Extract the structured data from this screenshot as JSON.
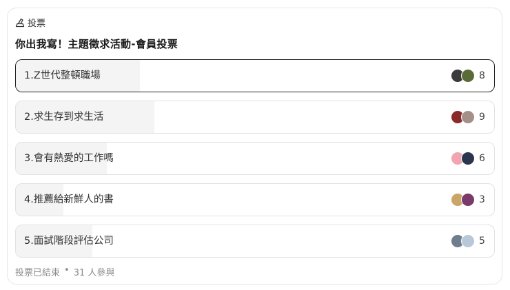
{
  "header": {
    "label": "投票",
    "icon": "ballot-icon"
  },
  "title": "你出我寫！主題徵求活動-會員投票",
  "options": [
    {
      "label": "1.Z世代整頓職場",
      "count": "8",
      "fill": 0.26,
      "selected": true,
      "avatars": [
        "#3b3b3b",
        "#5a6b3a"
      ]
    },
    {
      "label": "2.求生存到求生活",
      "count": "9",
      "fill": 0.29,
      "selected": false,
      "avatars": [
        "#8b2a2a",
        "#a49088"
      ]
    },
    {
      "label": "3.會有熱愛的工作嗎",
      "count": "6",
      "fill": 0.19,
      "selected": false,
      "avatars": [
        "#f2a4b0",
        "#2a3550"
      ]
    },
    {
      "label": "4.推薦給新鮮人的書",
      "count": "3",
      "fill": 0.1,
      "selected": false,
      "avatars": [
        "#c9a56a",
        "#7a3a6a"
      ]
    },
    {
      "label": "5.面試階段評估公司",
      "count": "5",
      "fill": 0.16,
      "selected": false,
      "avatars": [
        "#6e7e8e",
        "#b8c8d8"
      ]
    }
  ],
  "footer": {
    "status": "投票已結束",
    "separator": "•",
    "participants": "31 人參與"
  }
}
